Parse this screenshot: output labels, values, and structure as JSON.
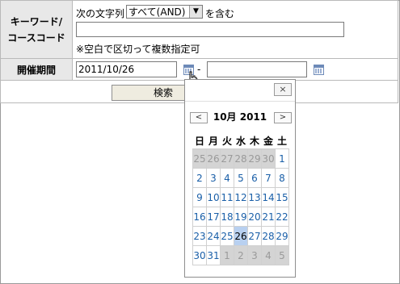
{
  "form": {
    "keyword_label_line1": "キーワード/",
    "keyword_label_line2": "コースコード",
    "keyword_prefix": "次の文字列",
    "match_select_value": "すべて(AND)",
    "keyword_suffix": "を含む",
    "keyword_value": "",
    "keyword_hint": "※空白で区切って複数指定可",
    "period_label": "開催期間",
    "date_from": "2011/10/26",
    "date_separator": "-",
    "date_to": "",
    "search_button": "検索"
  },
  "calendar": {
    "close_label": "×",
    "prev_label": "<",
    "next_label": ">",
    "month_title": "10月 2011",
    "weekdays": [
      "日",
      "月",
      "火",
      "水",
      "木",
      "金",
      "土"
    ],
    "weeks": [
      [
        {
          "d": "25",
          "o": true
        },
        {
          "d": "26",
          "o": true
        },
        {
          "d": "27",
          "o": true
        },
        {
          "d": "28",
          "o": true
        },
        {
          "d": "29",
          "o": true
        },
        {
          "d": "30",
          "o": true
        },
        {
          "d": "1",
          "o": false
        }
      ],
      [
        {
          "d": "2"
        },
        {
          "d": "3"
        },
        {
          "d": "4"
        },
        {
          "d": "5"
        },
        {
          "d": "6"
        },
        {
          "d": "7"
        },
        {
          "d": "8"
        }
      ],
      [
        {
          "d": "9"
        },
        {
          "d": "10"
        },
        {
          "d": "11"
        },
        {
          "d": "12"
        },
        {
          "d": "13"
        },
        {
          "d": "14"
        },
        {
          "d": "15"
        }
      ],
      [
        {
          "d": "16"
        },
        {
          "d": "17"
        },
        {
          "d": "18"
        },
        {
          "d": "19"
        },
        {
          "d": "20"
        },
        {
          "d": "21"
        },
        {
          "d": "22"
        }
      ],
      [
        {
          "d": "23"
        },
        {
          "d": "24"
        },
        {
          "d": "25"
        },
        {
          "d": "26",
          "s": true
        },
        {
          "d": "27"
        },
        {
          "d": "28"
        },
        {
          "d": "29"
        }
      ],
      [
        {
          "d": "30"
        },
        {
          "d": "31"
        },
        {
          "d": "1",
          "o": true
        },
        {
          "d": "2",
          "o": true
        },
        {
          "d": "3",
          "o": true
        },
        {
          "d": "4",
          "o": true
        },
        {
          "d": "5",
          "o": true
        }
      ]
    ],
    "selected_color": "#b8d0f0",
    "day_color": "#1a5fa8"
  }
}
